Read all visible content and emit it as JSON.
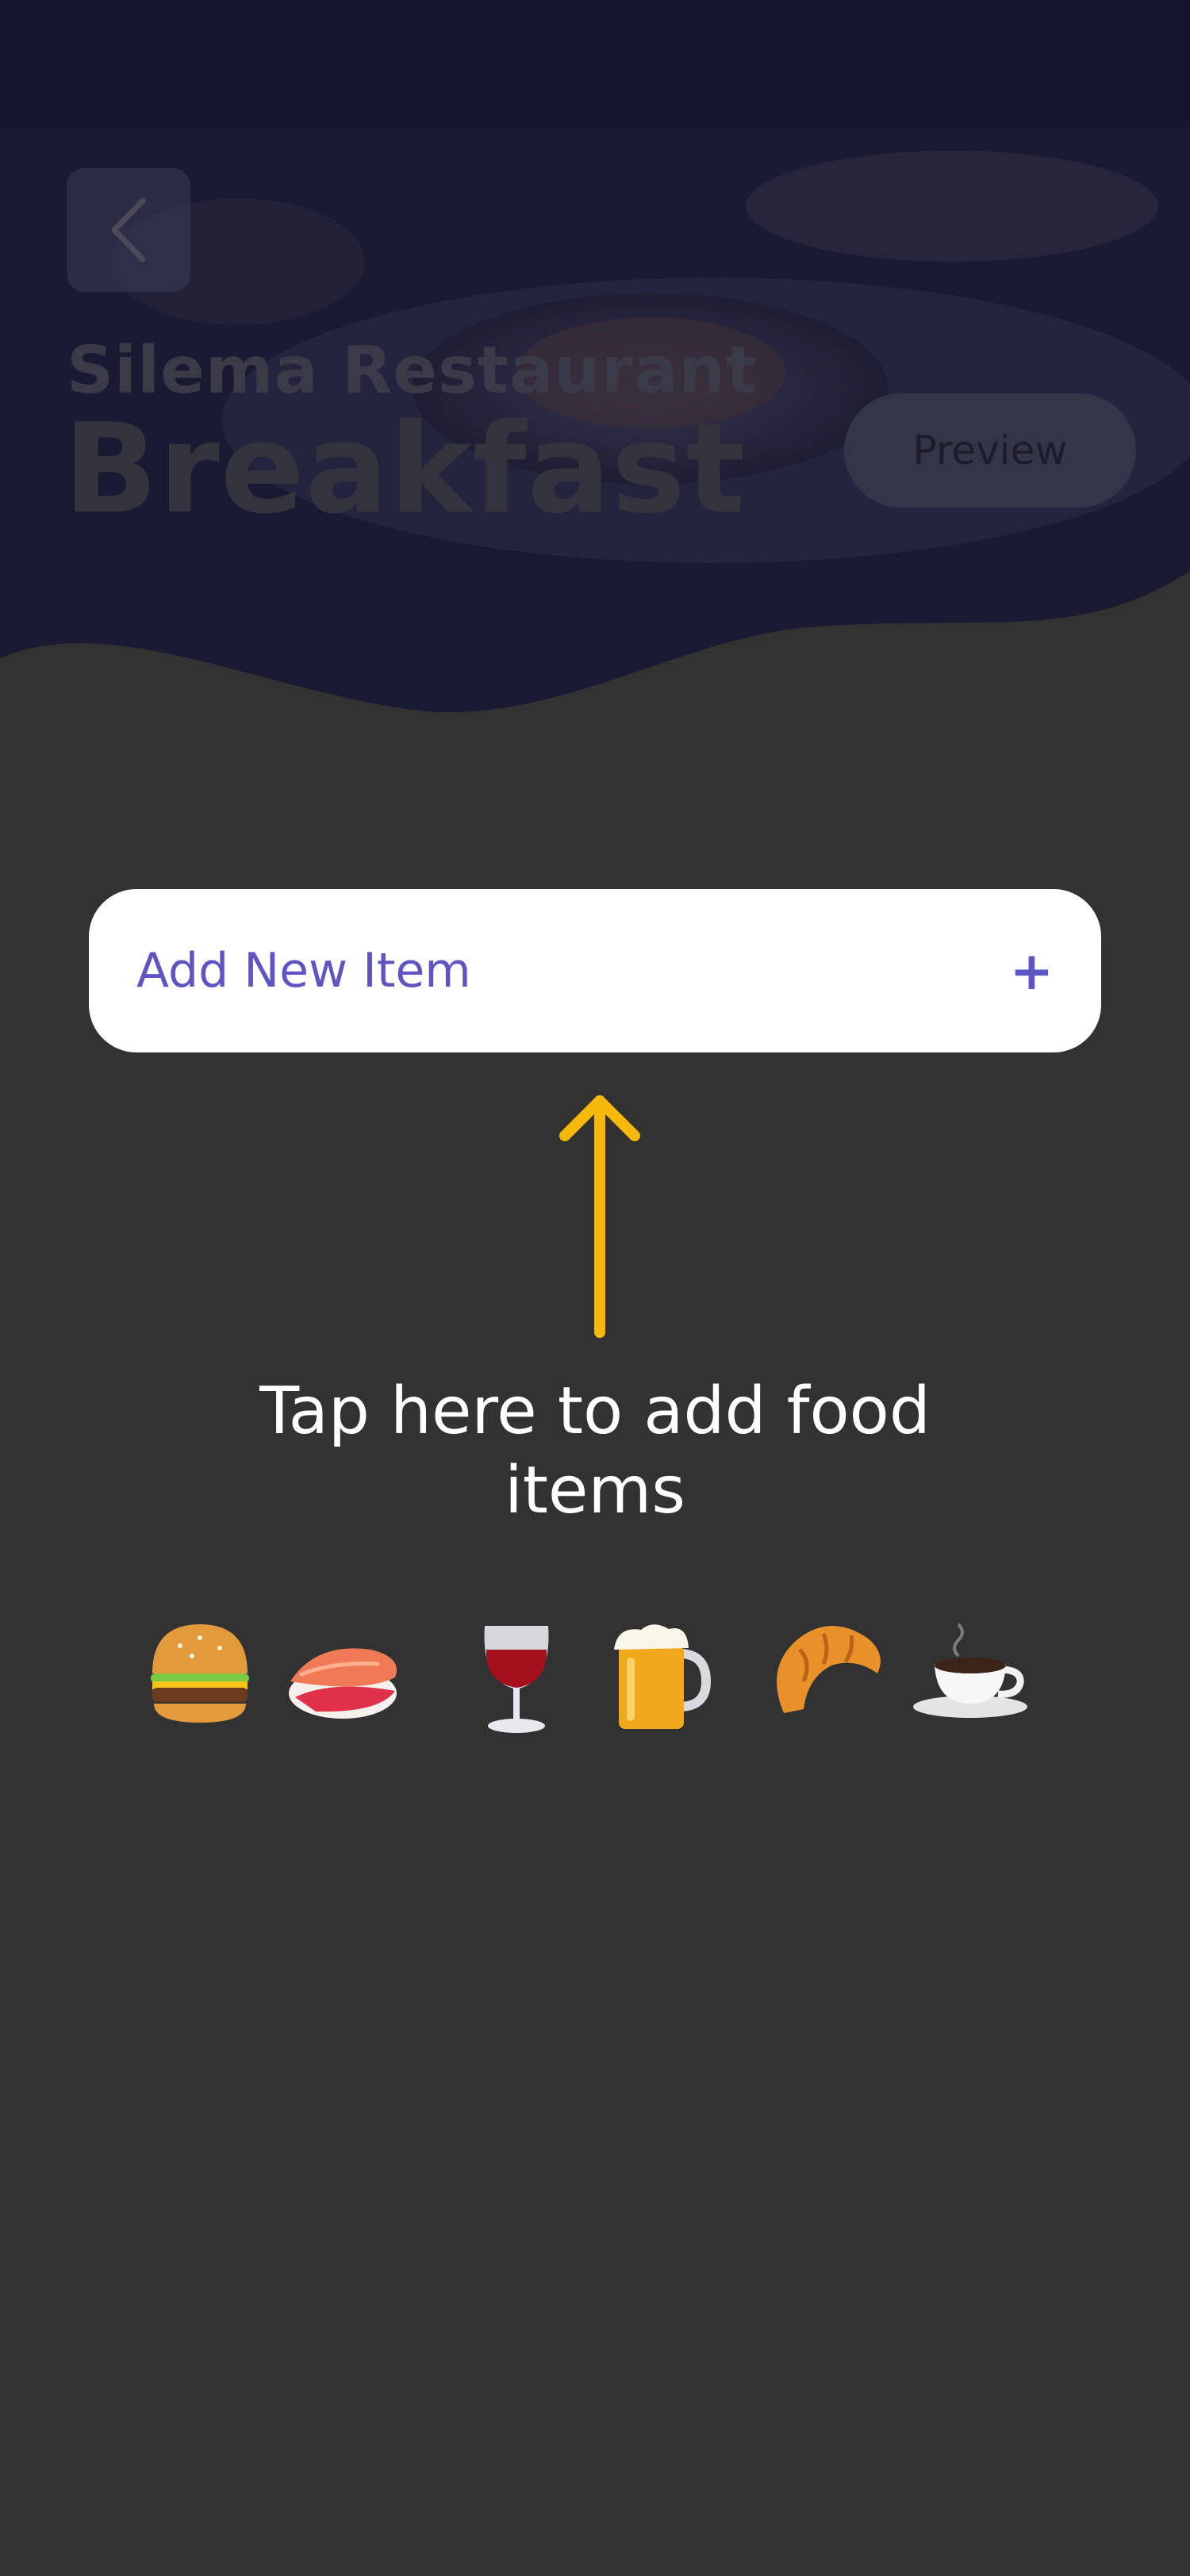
{
  "header": {
    "restaurant_name": "Silema Restaurant",
    "menu_title": "Breakfast",
    "preview_label": "Preview"
  },
  "add_item": {
    "label": "Add New Item",
    "plus": "+"
  },
  "hint": {
    "line1": "Tap here to add food",
    "line2": "items"
  },
  "emojis": [
    "hamburger-icon",
    "sushi-icon",
    "wine-glass-icon",
    "beer-mug-icon",
    "croissant-icon",
    "coffee-icon"
  ],
  "colors": {
    "background": "#323232",
    "hero_overlay": "#1b1a33",
    "accent": "#5e55c2",
    "arrow": "#f5b80b",
    "card": "#ffffff"
  }
}
